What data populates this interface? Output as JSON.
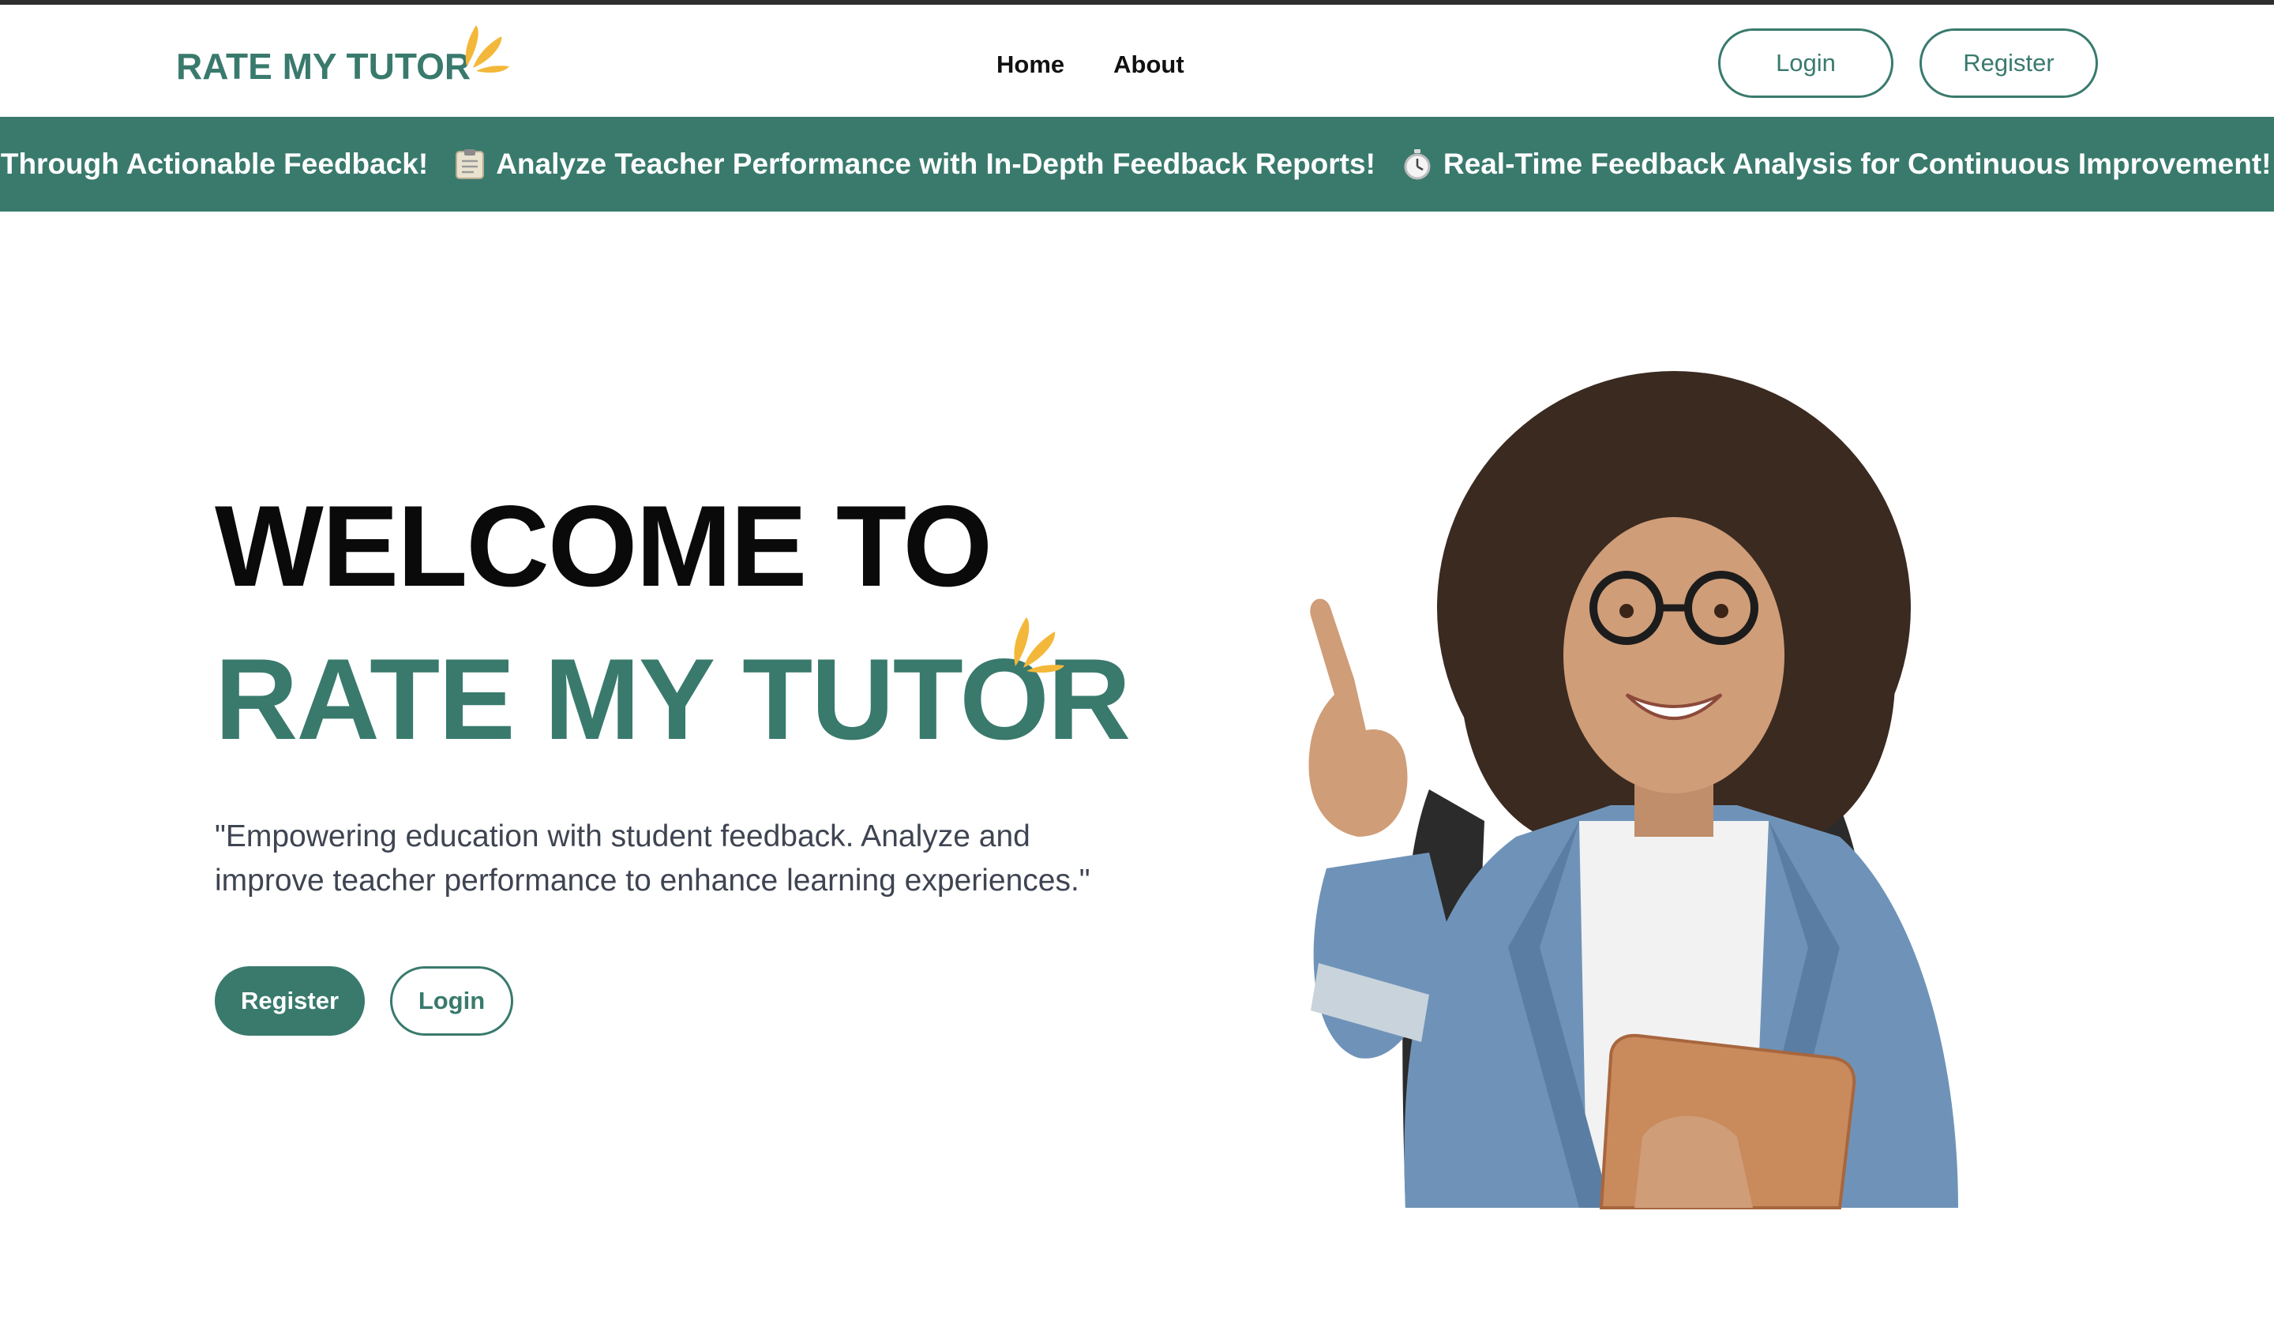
{
  "header": {
    "logo_text": "RATE MY TUTOR",
    "nav": [
      {
        "label": "Home"
      },
      {
        "label": "About"
      }
    ],
    "login_label": "Login",
    "register_label": "Register"
  },
  "ticker": {
    "items": [
      {
        "icon": "",
        "text": "s Through Actionable Feedback!"
      },
      {
        "icon": "clipboard-icon",
        "text": "Analyze Teacher Performance with In-Depth Feedback Reports!"
      },
      {
        "icon": "stopwatch-icon",
        "text": "Real-Time Feedback Analysis for Continuous Improvement!"
      }
    ]
  },
  "hero": {
    "heading_line1": "WELCOME TO",
    "heading_line2": "RATE MY TUTOR",
    "description": "\"Empowering education with student feedback. Analyze and improve teacher performance to enhance learning experiences.\"",
    "register_label": "Register",
    "login_label": "Login",
    "image": "student-with-tablet-pointing-up-illustration"
  },
  "colors": {
    "brand": "#397a6d",
    "accent": "#f3b83a",
    "text_dark": "#0a0a0a",
    "text_muted": "#3f4452"
  }
}
